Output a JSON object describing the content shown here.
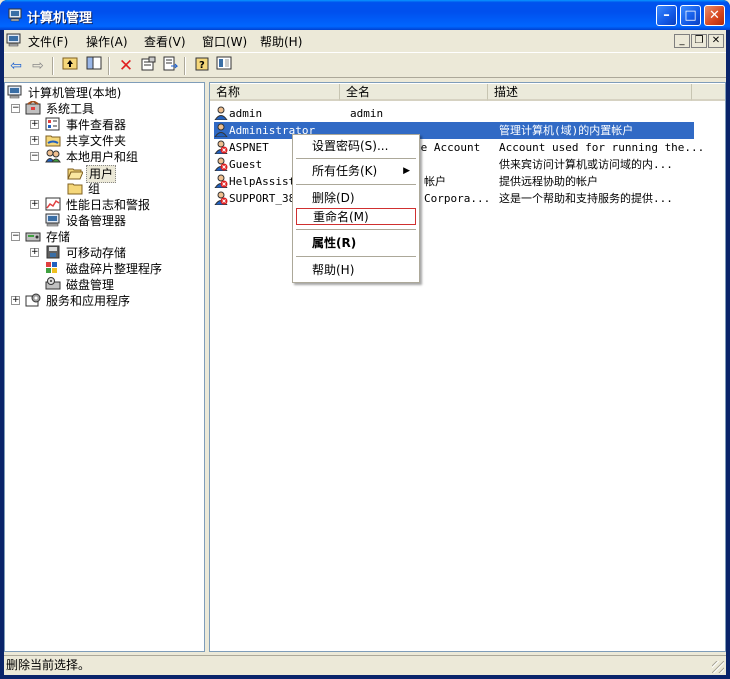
{
  "window": {
    "title": "计算机管理"
  },
  "menu": [
    "文件(F)",
    "操作(A)",
    "查看(V)",
    "窗口(W)",
    "帮助(H)"
  ],
  "toolbar": [
    "back-icon",
    "forward-icon",
    "up-icon",
    "show-tree-icon",
    "delete-icon",
    "properties-icon",
    "export-icon",
    "help-icon",
    "console-icon"
  ],
  "tree": [
    {
      "label": "计算机管理(本地)",
      "icon": "computer-icon"
    },
    {
      "label": "系统工具",
      "icon": "tools-icon"
    },
    {
      "label": "事件查看器",
      "icon": "event-viewer-icon"
    },
    {
      "label": "共享文件夹",
      "icon": "shared-folder-icon"
    },
    {
      "label": "本地用户和组",
      "icon": "users-groups-icon"
    },
    {
      "label": "用户",
      "icon": "folder-open-icon"
    },
    {
      "label": "组",
      "icon": "folder-icon"
    },
    {
      "label": "性能日志和警报",
      "icon": "performance-icon"
    },
    {
      "label": "设备管理器",
      "icon": "device-manager-icon"
    },
    {
      "label": "存储",
      "icon": "storage-icon"
    },
    {
      "label": "可移动存储",
      "icon": "removable-storage-icon"
    },
    {
      "label": "磁盘碎片整理程序",
      "icon": "defrag-icon"
    },
    {
      "label": "磁盘管理",
      "icon": "disk-management-icon"
    },
    {
      "label": "服务和应用程序",
      "icon": "services-icon"
    }
  ],
  "columns": [
    "名称",
    "全名",
    "描述"
  ],
  "users": [
    {
      "name": "admin",
      "fullname": "admin",
      "desc": ""
    },
    {
      "name": "Administrator",
      "fullname": "",
      "desc": "管理计算机(域)的内置帐户"
    },
    {
      "name": "ASPNET",
      "fullname": "ne Account",
      "desc": "Account used for running the..."
    },
    {
      "name": "Guest",
      "fullname": "",
      "desc": "供来宾访问计算机或访问域的内..."
    },
    {
      "name": "HelpAssista",
      "fullname": "帐户",
      "desc": "提供远程协助的帐户"
    },
    {
      "name": "SUPPORT_388",
      "fullname": "Corpora...",
      "desc": "这是一个帮助和支持服务的提供..."
    }
  ],
  "context_menu": [
    {
      "label": "设置密码(S)..."
    },
    {
      "label": "所有任务(K)"
    },
    {
      "label": "删除(D)"
    },
    {
      "label": "重命名(M)"
    },
    {
      "label": "属性(R)"
    },
    {
      "label": "帮助(H)"
    }
  ],
  "status": "删除当前选择。",
  "colors": {
    "selection": "#316ac5",
    "titlebar": "#0053ee",
    "highlight_border": "#d03030"
  }
}
